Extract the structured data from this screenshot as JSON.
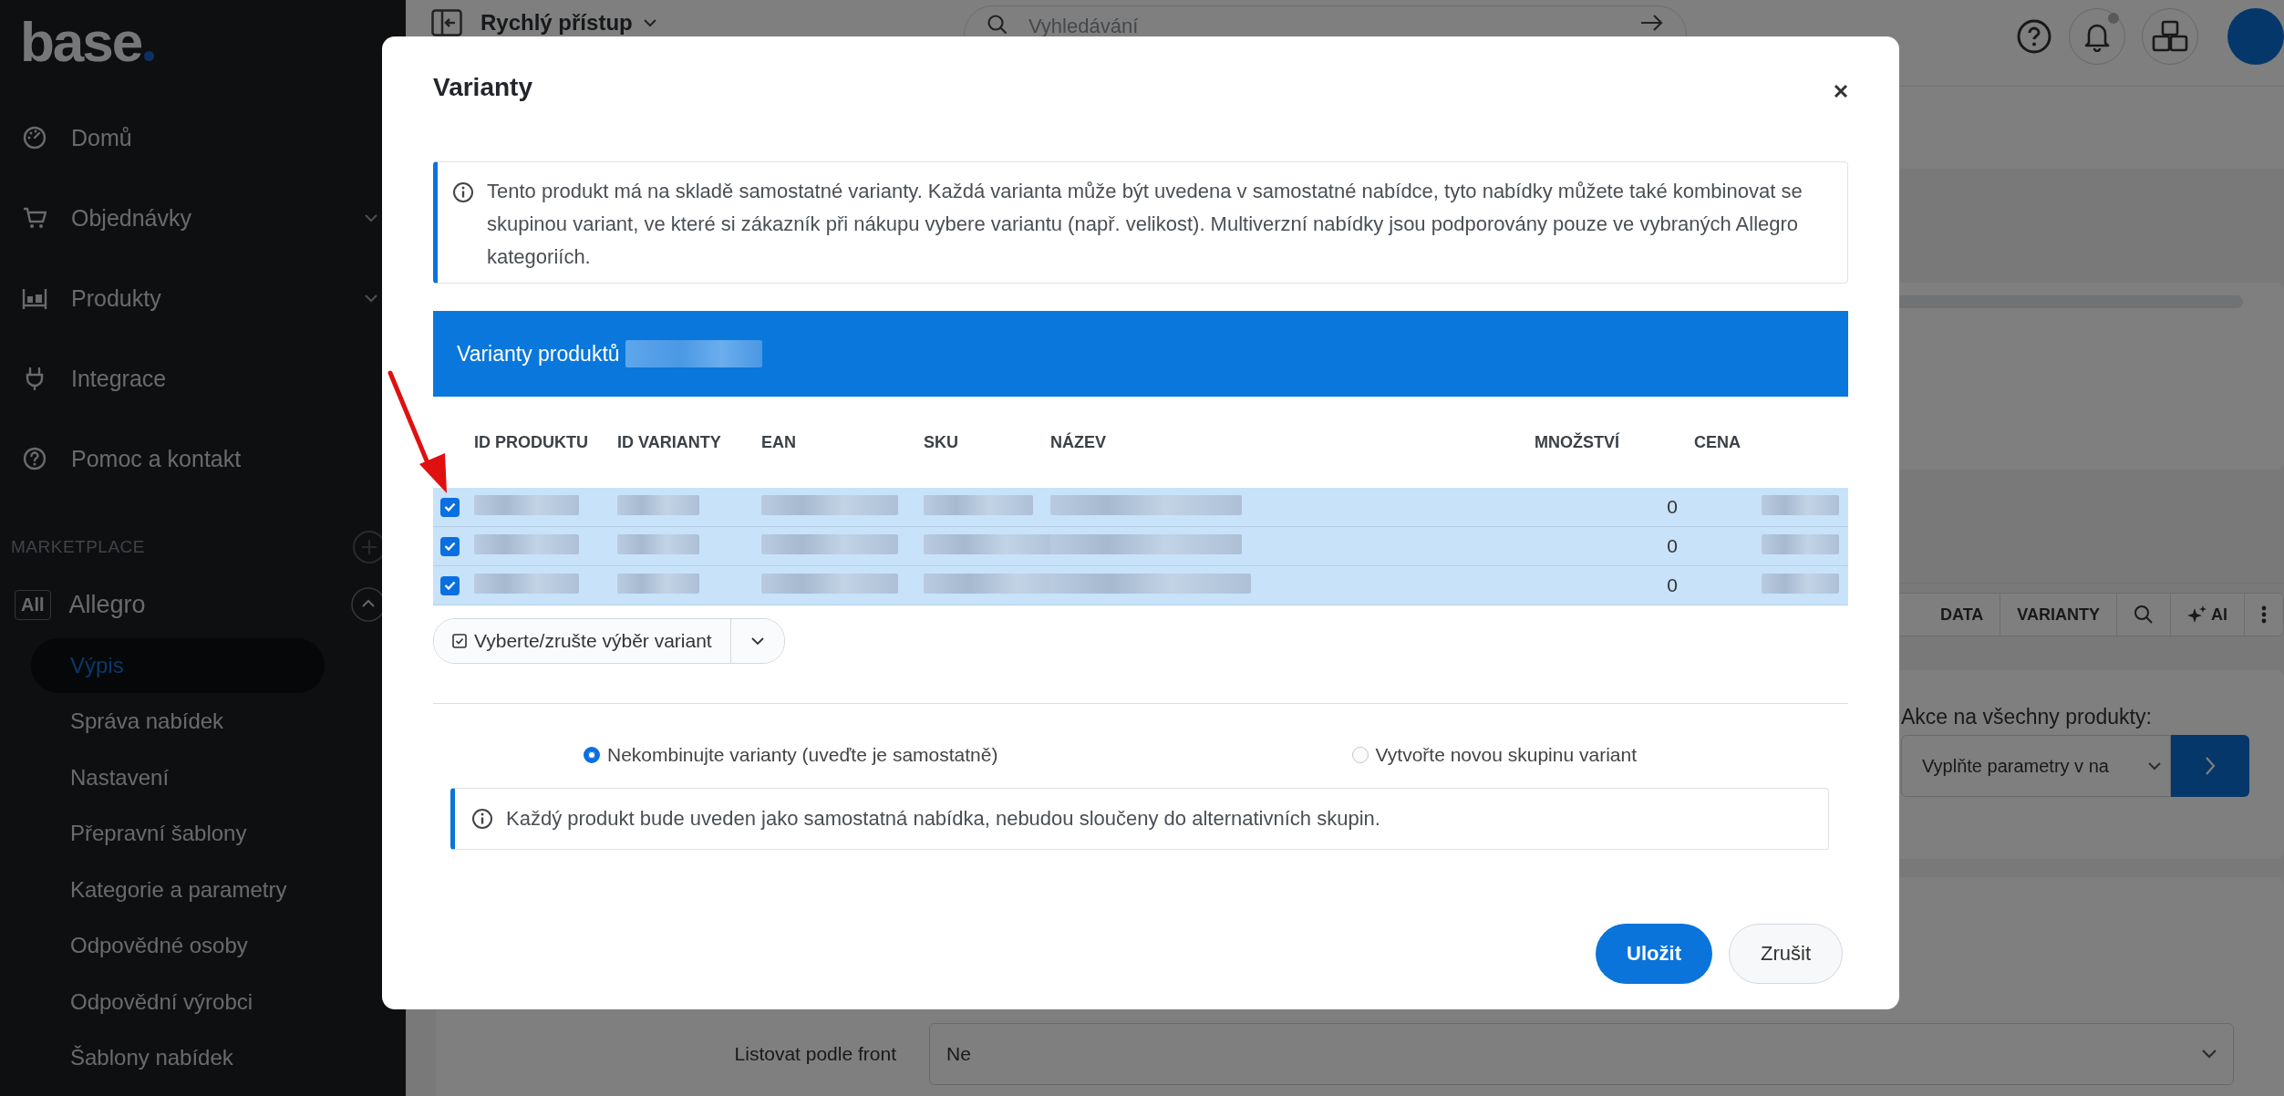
{
  "sidebar": {
    "logo": "base",
    "nav": [
      {
        "label": "Domů",
        "kind": "gauge",
        "has_submenu": false
      },
      {
        "label": "Objednávky",
        "kind": "cart",
        "has_submenu": true
      },
      {
        "label": "Produkty",
        "kind": "shelf",
        "has_submenu": true
      },
      {
        "label": "Integrace",
        "kind": "plug",
        "has_submenu": false
      },
      {
        "label": "Pomoc a kontakt",
        "kind": "help",
        "has_submenu": false
      }
    ],
    "section": "MARKETPLACE",
    "channels": [
      {
        "badge": "All",
        "label": "Allegro",
        "expanded": true,
        "children": [
          {
            "label": "Výpis",
            "selected": true
          },
          {
            "label": "Správa nabídek",
            "selected": false
          },
          {
            "label": "Nastavení",
            "selected": false
          },
          {
            "label": "Přepravní šablony",
            "selected": false
          },
          {
            "label": "Kategorie a parametry",
            "selected": false
          },
          {
            "label": "Odpovědné osoby",
            "selected": false
          },
          {
            "label": "Odpovědní výrobci",
            "selected": false
          },
          {
            "label": "Šablony nabídek",
            "selected": false
          }
        ]
      }
    ]
  },
  "topbar": {
    "quick_access": "Rychlý přístup",
    "search_placeholder": "Vyhledávání",
    "notification_dot": true
  },
  "main": {
    "toolbar": [
      {
        "kind": "text",
        "label": "DATA"
      },
      {
        "kind": "text",
        "label": "VARIANTY"
      },
      {
        "kind": "search"
      },
      {
        "kind": "ai",
        "label": "AI"
      },
      {
        "kind": "more"
      }
    ],
    "bulk_action": {
      "label": "Akce na všechny produkty:",
      "value": "Vyplňte parametry v na"
    },
    "listing": {
      "label": "Listovat podle front",
      "value": "Ne"
    }
  },
  "modal": {
    "title": "Varianty",
    "info": "Tento produkt má na skladě samostatné varianty. Každá varianta může být uvedena v samostatné nabídce, tyto nabídky můžete také kombinovat se skupinou variant, ve které si zákazník při nákupu vybere variantu (např. velikost). Multiverzní nabídky jsou podporovány pouze ve vybraných Allegro kategoriích.",
    "table_title": "Varianty produktů",
    "columns": [
      "ID PRODUKTU",
      "ID VARIANTY",
      "EAN",
      "SKU",
      "NÁZEV",
      "MNOŽSTVÍ",
      "CENA"
    ],
    "rows": [
      {
        "checked": true,
        "quantity": "0"
      },
      {
        "checked": true,
        "quantity": "0"
      },
      {
        "checked": true,
        "quantity": "0"
      }
    ],
    "select_button": "Vyberte/zrušte výběr variant",
    "options": [
      {
        "label": "Nekombinujte varianty (uveďte je samostatně)",
        "selected": true
      },
      {
        "label": "Vytvořte novou skupinu variant",
        "selected": false
      }
    ],
    "option_hint": "Každý produkt bude uveden jako samostatná nabídka, nebudou sloučeny do alternativních skupin.",
    "buttons": [
      {
        "label": "Uložit",
        "kind": "primary"
      },
      {
        "label": "Zrušit",
        "kind": "secondary"
      }
    ]
  }
}
